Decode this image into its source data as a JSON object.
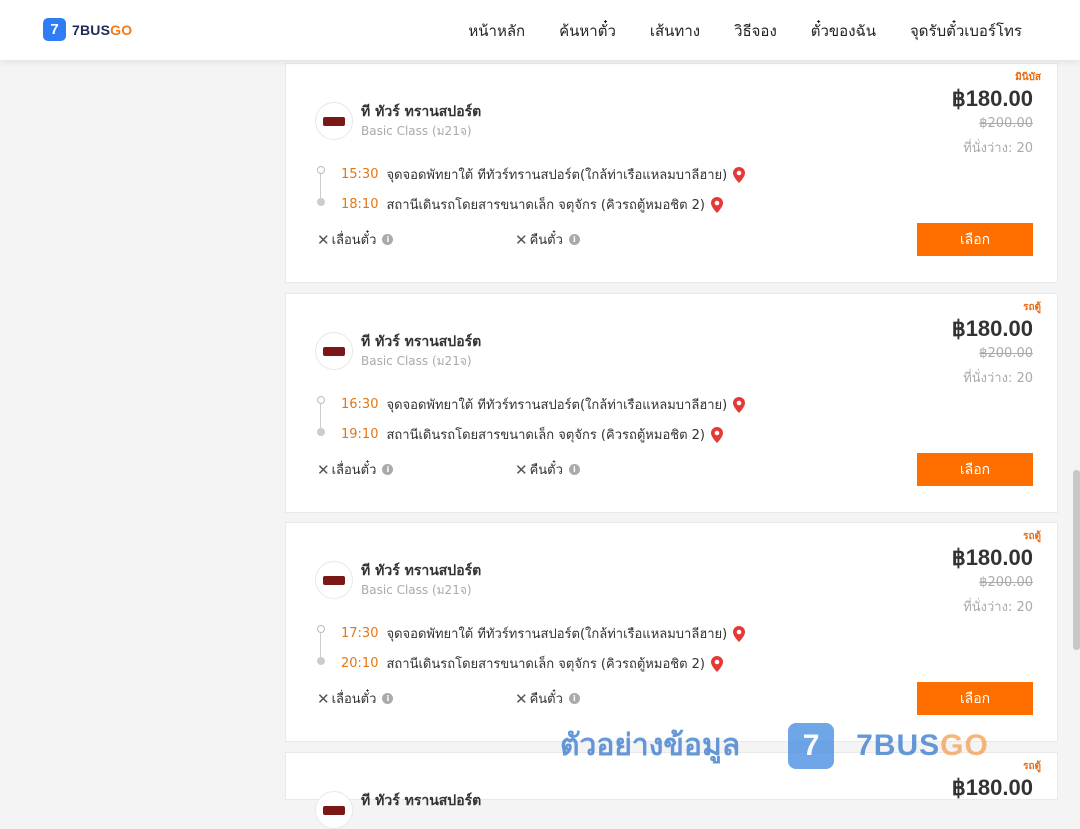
{
  "brand": {
    "logo_mark": "7",
    "name_blue": "7BUS",
    "name_orange": "GO"
  },
  "nav": [
    "หน้าหลัก",
    "ค้นหาตั๋ว",
    "เส้นทาง",
    "วิธีจอง",
    "ตั๋วของฉัน",
    "จุดรับตั๋วเบอร์โทร"
  ],
  "cards": [
    {
      "tag": "มินิบัส",
      "operator": "ที ทัวร์ ทรานสปอร์ต",
      "bus_class": "Basic Class (ม21จ)",
      "price": "฿180.00",
      "old_price": "฿200.00",
      "seats": "ที่นั่งว่าง: 20",
      "depart_time": "15:30",
      "depart_place": "จุดจอดพัทยาใต้ ทีทัวร์ทรานสปอร์ต(ใกล้ท่าเรือแหลมบาลีฮาย)",
      "arrive_time": "18:10",
      "arrive_place": "สถานีเดินรถโดยสารขนาดเล็ก จตุจักร (คิวรถตู้หมอชิต 2)",
      "reschedule": "เลื่อนตั๋ว",
      "refund": "คืนตั๋ว",
      "select": "เลือก"
    },
    {
      "tag": "รถตู้",
      "operator": "ที ทัวร์ ทรานสปอร์ต",
      "bus_class": "Basic Class (ม21จ)",
      "price": "฿180.00",
      "old_price": "฿200.00",
      "seats": "ที่นั่งว่าง: 20",
      "depart_time": "16:30",
      "depart_place": "จุดจอดพัทยาใต้ ทีทัวร์ทรานสปอร์ต(ใกล้ท่าเรือแหลมบาลีฮาย)",
      "arrive_time": "19:10",
      "arrive_place": "สถานีเดินรถโดยสารขนาดเล็ก จตุจักร (คิวรถตู้หมอชิต 2)",
      "reschedule": "เลื่อนตั๋ว",
      "refund": "คืนตั๋ว",
      "select": "เลือก"
    },
    {
      "tag": "รถตู้",
      "operator": "ที ทัวร์ ทรานสปอร์ต",
      "bus_class": "Basic Class (ม21จ)",
      "price": "฿180.00",
      "old_price": "฿200.00",
      "seats": "ที่นั่งว่าง: 20",
      "depart_time": "17:30",
      "depart_place": "จุดจอดพัทยาใต้ ทีทัวร์ทรานสปอร์ต(ใกล้ท่าเรือแหลมบาลีฮาย)",
      "arrive_time": "20:10",
      "arrive_place": "สถานีเดินรถโดยสารขนาดเล็ก จตุจักร (คิวรถตู้หมอชิต 2)",
      "reschedule": "เลื่อนตั๋ว",
      "refund": "คืนตั๋ว",
      "select": "เลือก"
    },
    {
      "tag": "รถตู้",
      "operator": "ที ทัวร์ ทรานสปอร์ต",
      "price": "฿180.00"
    }
  ],
  "watermark": {
    "text": "ตัวอย่างข้อมูล",
    "badge": "7",
    "brand_blue": "7BUS",
    "brand_orange": "GO"
  },
  "colors": {
    "accent": "#ff6f00",
    "time": "#e67614",
    "pin": "#e53935",
    "logo_blue": "#2e7df5"
  }
}
